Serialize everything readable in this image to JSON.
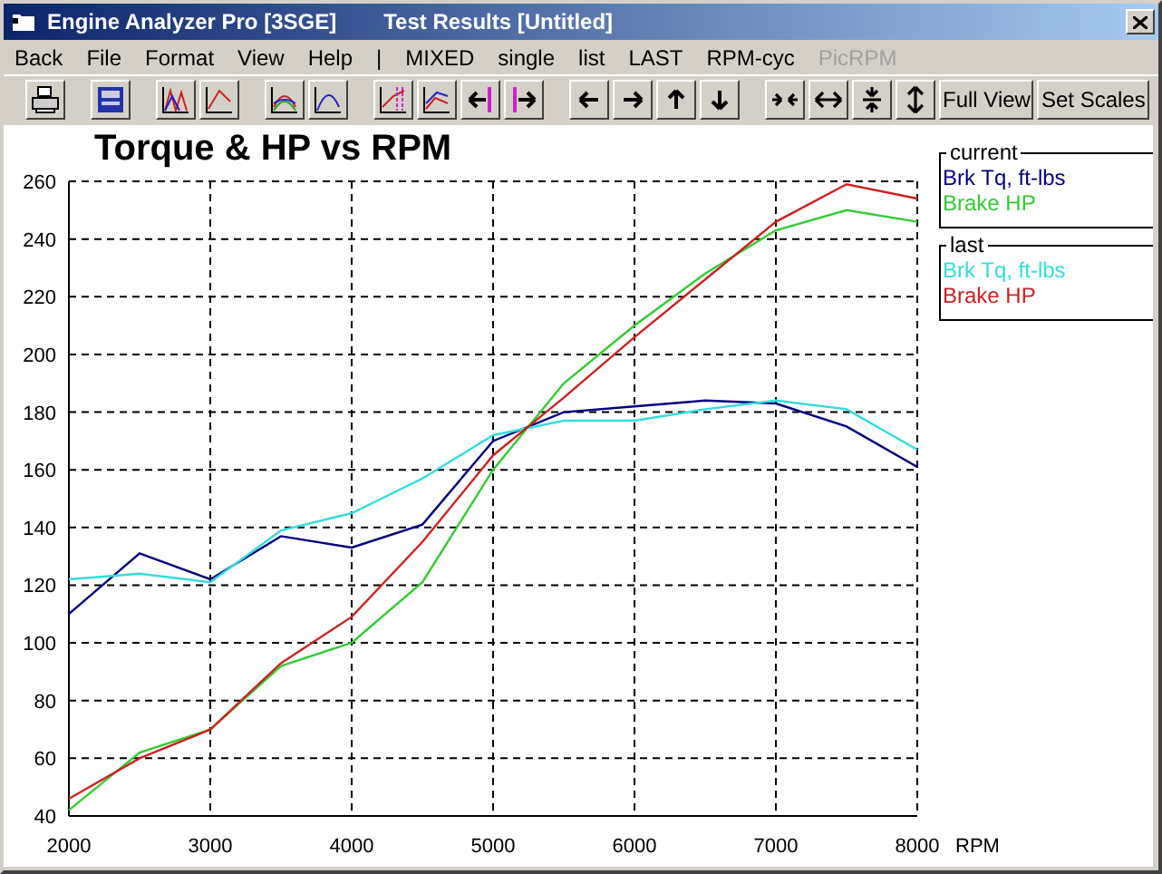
{
  "window": {
    "title": "Engine Analyzer Pro [3SGE]",
    "document": "Test Results [Untitled]"
  },
  "menu": [
    {
      "label": "Back",
      "disabled": false
    },
    {
      "label": "File",
      "disabled": false
    },
    {
      "label": "Format",
      "disabled": false
    },
    {
      "label": "View",
      "disabled": false
    },
    {
      "label": "Help",
      "disabled": false
    },
    {
      "label": "|",
      "disabled": false
    },
    {
      "label": "MIXED",
      "disabled": false
    },
    {
      "label": "single",
      "disabled": false
    },
    {
      "label": "list",
      "disabled": false
    },
    {
      "label": "LAST",
      "disabled": false
    },
    {
      "label": "RPM-cyc",
      "disabled": false
    },
    {
      "label": "PicRPM",
      "disabled": true
    }
  ],
  "toolbar": [
    [
      {
        "kind": "icon"
      }
    ],
    [
      {
        "kind": "icon"
      }
    ],
    [
      {
        "kind": "icon"
      },
      {
        "kind": "icon"
      }
    ],
    [
      {
        "kind": "icon"
      },
      {
        "kind": "icon"
      }
    ],
    [
      {
        "kind": "icon"
      },
      {
        "kind": "icon"
      },
      {
        "kind": "icon"
      },
      {
        "kind": "icon"
      }
    ],
    [
      {
        "kind": "icon"
      },
      {
        "kind": "icon"
      },
      {
        "kind": "icon"
      },
      {
        "kind": "icon"
      }
    ],
    [
      {
        "kind": "icon"
      },
      {
        "kind": "icon"
      },
      {
        "kind": "icon"
      },
      {
        "kind": "icon"
      },
      {
        "kind": "text",
        "label": "Full View"
      },
      {
        "kind": "text",
        "label": "Set Scales"
      }
    ]
  ],
  "legend_groups": [
    {
      "title": "current"
    },
    {
      "title": "last"
    }
  ],
  "chart": {
    "chart_data": {
      "type": "line",
      "grid": true,
      "title": "Torque & HP vs RPM",
      "xlabel": "RPM",
      "x": [
        2000,
        2500,
        3000,
        3500,
        4000,
        4500,
        5000,
        5500,
        6000,
        6500,
        7000,
        7500,
        8000
      ],
      "xlim": [
        2000,
        8000
      ],
      "ylim": [
        40,
        260
      ],
      "xticks": [
        2000,
        3000,
        4000,
        5000,
        6000,
        7000,
        8000
      ],
      "yticks": [
        40,
        60,
        80,
        100,
        120,
        140,
        160,
        180,
        200,
        220,
        240,
        260
      ],
      "series": [
        {
          "name": "Brk Tq, ft-lbs",
          "color": "#000080",
          "values": [
            110,
            131,
            122,
            137,
            133,
            141,
            170,
            180,
            182,
            184,
            183,
            175,
            161
          ]
        },
        {
          "name": "Brake HP",
          "color": "#33cc33",
          "values": [
            42,
            62,
            70,
            92,
            100,
            121,
            160,
            190,
            210,
            228,
            243,
            250,
            246
          ]
        },
        {
          "name": "Brk Tq, ft-lbs",
          "color": "#33dddd",
          "values": [
            122,
            124,
            121,
            139,
            145,
            157,
            172,
            177,
            177,
            181,
            184,
            181,
            167
          ]
        },
        {
          "name": "Brake HP",
          "color": "#cc2222",
          "values": [
            46,
            60,
            70,
            93,
            109,
            135,
            165,
            185,
            206,
            226,
            246,
            259,
            254
          ]
        }
      ]
    }
  }
}
